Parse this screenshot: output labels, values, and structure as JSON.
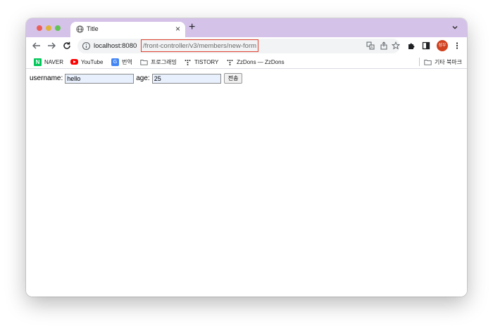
{
  "tab": {
    "title": "Title"
  },
  "omnibox": {
    "host": "localhost:8080",
    "path": "/front-controller/v3/members/new-form"
  },
  "profile": {
    "initials": "성우"
  },
  "bookmarks": {
    "items": [
      {
        "label": "NAVER",
        "icon": "naver-icon"
      },
      {
        "label": "YouTube",
        "icon": "youtube-icon"
      },
      {
        "label": "번역",
        "icon": "translate-icon"
      },
      {
        "label": "프로그래밍",
        "icon": "folder-icon"
      },
      {
        "label": "TISTORY",
        "icon": "tistory-icon"
      },
      {
        "label": "ZzDons — ZzDons",
        "icon": "tistory-icon"
      }
    ],
    "other": "기타 북마크"
  },
  "form": {
    "username_label": "username:",
    "username_value": "hello",
    "age_label": "age:",
    "age_value": "25",
    "submit_label": "전송"
  },
  "colors": {
    "tabstrip": "#d4c2e8",
    "highlight_border": "#e2412d",
    "avatar": "#d0411f"
  }
}
